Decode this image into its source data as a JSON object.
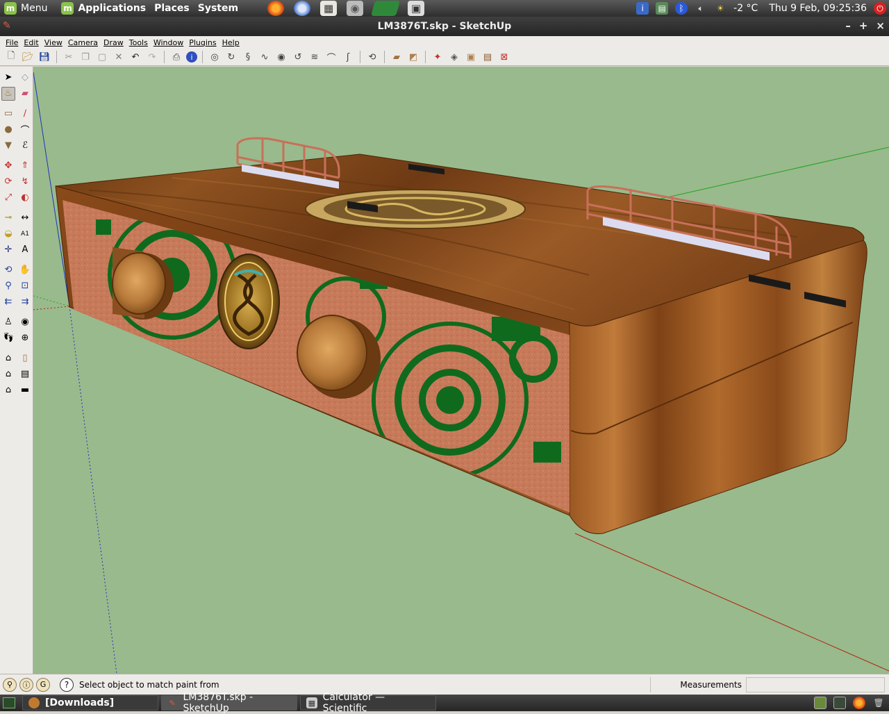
{
  "top_panel": {
    "menu_label": "Menu",
    "applications": "Applications",
    "places": "Places",
    "system": "System",
    "weather": "-2 °C",
    "clock": "Thu  9 Feb, 09:25:36"
  },
  "window": {
    "title": "LM3876T.skp - SketchUp",
    "min": "–",
    "max": "+",
    "close": "×"
  },
  "menu": {
    "items": [
      "File",
      "Edit",
      "View",
      "Camera",
      "Draw",
      "Tools",
      "Window",
      "Plugins",
      "Help"
    ]
  },
  "status": {
    "hint": "Select object to match paint from",
    "measurements_label": "Measurements",
    "measurements_value": ""
  },
  "taskbar": {
    "items": [
      {
        "label": "[Downloads]",
        "icon": "folder-icon"
      },
      {
        "label": "LM3876T.skp - SketchUp",
        "icon": "sketchup-icon"
      },
      {
        "label": "Calculator — Scientific",
        "icon": "calculator-icon"
      }
    ]
  },
  "colors": {
    "viewport_bg": "#99ba8c",
    "wood": "#8a4e1e",
    "copper": "#c77a5a",
    "green_pattern": "#0f6a1e",
    "panel": "#2e2e2e"
  }
}
